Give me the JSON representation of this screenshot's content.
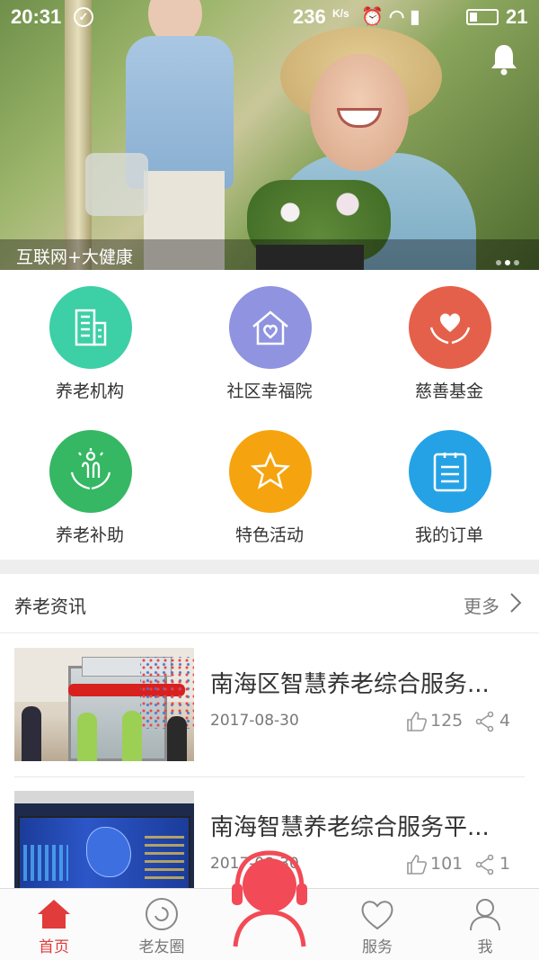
{
  "status_bar": {
    "time": "20:31",
    "net_speed": "236",
    "net_unit": "K/s",
    "battery": "21"
  },
  "banner": {
    "caption": "互联网+大健康",
    "dots": 3,
    "active_dot": 1
  },
  "menu": [
    {
      "label": "养老机构",
      "icon": "building-icon",
      "color": "#3dcfa6"
    },
    {
      "label": "社区幸福院",
      "icon": "home-heart-icon",
      "color": "#8f93e0"
    },
    {
      "label": "慈善基金",
      "icon": "heart-hands-icon",
      "color": "#e5604a"
    },
    {
      "label": "养老补助",
      "icon": "care-hands-icon",
      "color": "#35b764"
    },
    {
      "label": "特色活动",
      "icon": "star-icon",
      "color": "#f5a40f"
    },
    {
      "label": "我的订单",
      "icon": "clipboard-icon",
      "color": "#25a2e6"
    }
  ],
  "news": {
    "title": "养老资讯",
    "more": "更多",
    "articles": [
      {
        "title": "南海区智慧养老综合服务...",
        "date": "2017-08-30",
        "likes": "125",
        "shares": "4"
      },
      {
        "title": "南海智慧养老综合服务平...",
        "date": "2017-08-30",
        "likes": "101",
        "shares": "1"
      }
    ]
  },
  "tabbar": {
    "tabs": [
      {
        "label": "首页",
        "icon": "home-icon",
        "active": true
      },
      {
        "label": "老友圈",
        "icon": "circle-icon",
        "active": false
      },
      {
        "label": "服务",
        "icon": "heart-outline-icon",
        "active": false
      },
      {
        "label": "我",
        "icon": "person-icon",
        "active": false
      }
    ],
    "center_icon": "headset-person-icon"
  },
  "colors": {
    "accent": "#e23b3b",
    "divider": "#eeeeee"
  }
}
